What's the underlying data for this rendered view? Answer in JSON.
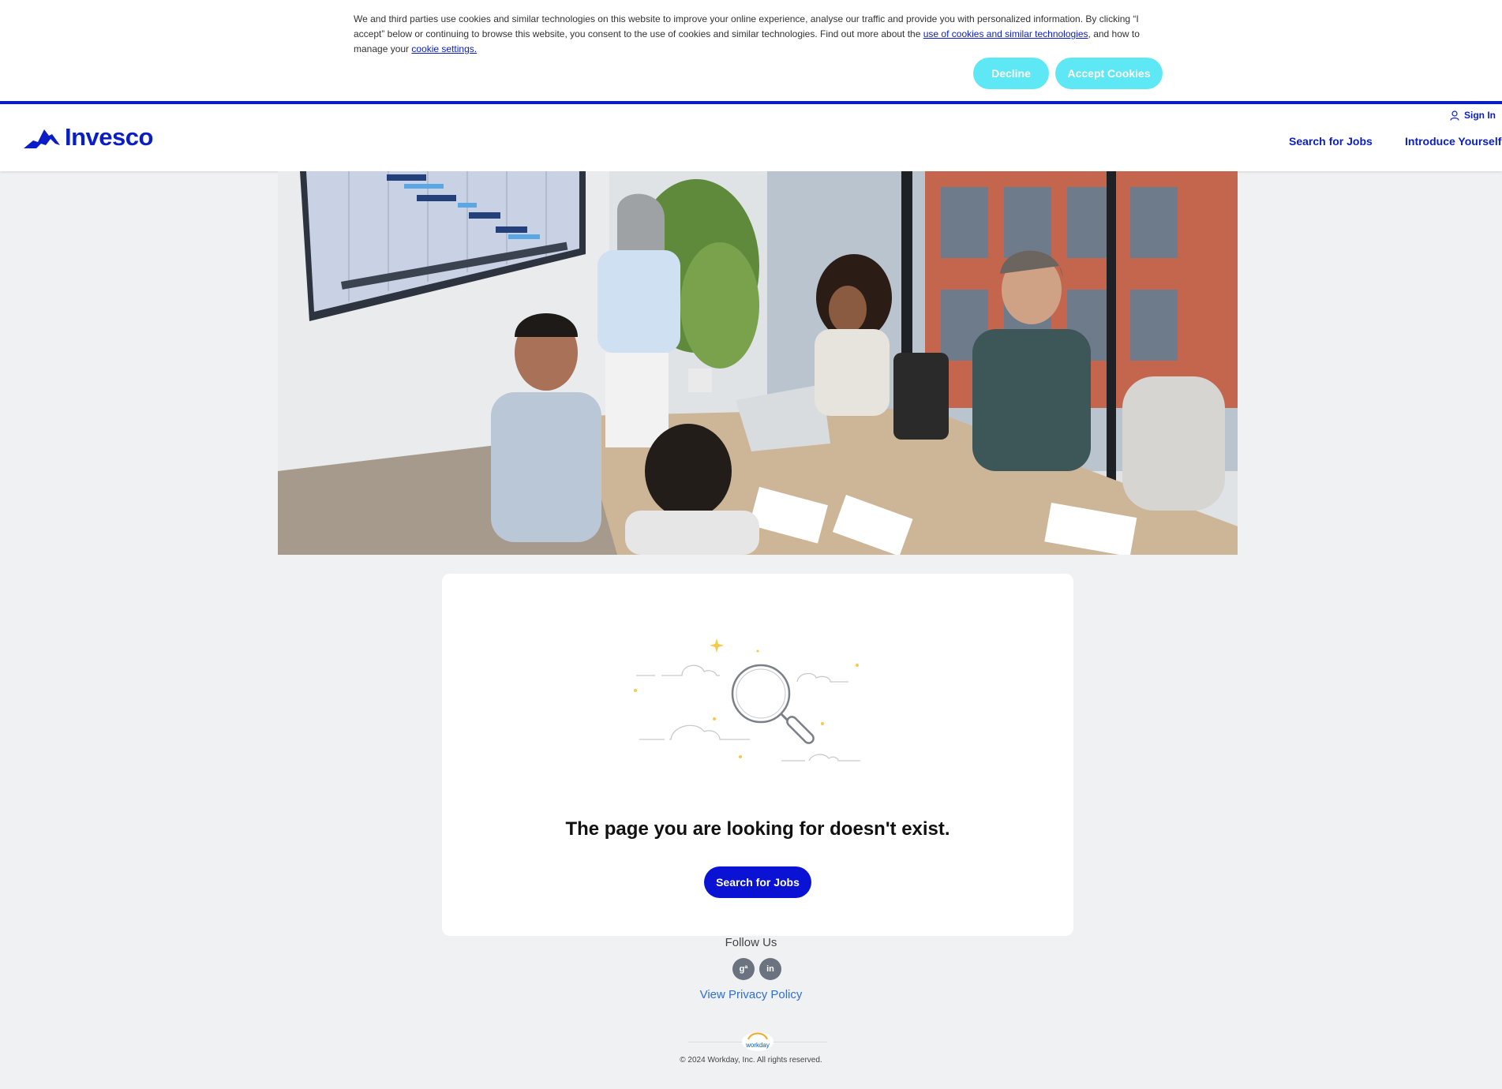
{
  "cookie": {
    "text_part1": "We and third parties use cookies and similar technologies on this website to improve your online experience, analyse our traffic and provide you with personalized information. By clicking “I accept” below or continuing to browse this website, you consent to the use of cookies and similar technologies. Find out more about the ",
    "link1": "use of cookies and similar technologies",
    "text_part2": ", and how to manage your ",
    "link2": "cookie settings.",
    "decline_label": "Decline",
    "accept_label": "Accept Cookies",
    "button_color": "#5ee8f5"
  },
  "header": {
    "logo_text": "Invesco",
    "signin_label": "Sign In",
    "nav": [
      "Search for Jobs",
      "Introduce Yourself"
    ],
    "brand_color": "#0a1ec8"
  },
  "hero": {
    "icon": "office-meeting-photo"
  },
  "card": {
    "message": "The page you are looking for doesn't exist.",
    "button_label": "Search for Jobs",
    "illustration": "magnifying-glass-clouds"
  },
  "footer": {
    "follow_label": "Follow Us",
    "socials": [
      {
        "name": "glassdoor",
        "glyph": "gª"
      },
      {
        "name": "linkedin",
        "glyph": "in"
      }
    ],
    "privacy_label": "View Privacy Policy",
    "workday_label": "workday",
    "copyright": "© 2024 Workday, Inc. All rights reserved."
  }
}
